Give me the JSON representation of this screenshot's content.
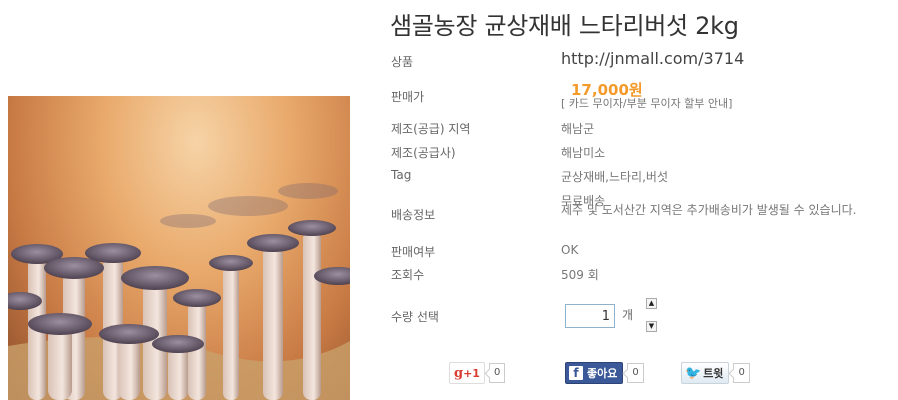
{
  "product": {
    "title": "샘골농장 균상재배 느타리버섯 2kg",
    "image_alt": "oyster-mushrooms-photo"
  },
  "details": {
    "product_label": "상품",
    "product_url": "http://jnmall.com/3714",
    "price_label": "판매가",
    "price": "17,000원",
    "installment_note": "[ 카드 무이자/부분 무이자 할부 안내]",
    "manufacturer_region_label": "제조(공급) 지역",
    "manufacturer_region": "해남군",
    "manufacturer_label": "제조(공급사)",
    "manufacturer": "해남미소",
    "tag_label": "Tag",
    "tags": "균상재배,느타리,버섯",
    "shipping_label": "배송정보",
    "shipping_free": "무료배송",
    "shipping_note": "제주 및 도서산간 지역은 추가배송비가 발생될 수 있습니다.",
    "sale_status_label": "판매여부",
    "sale_status": "OK",
    "views_label": "조회수",
    "views": "509 회"
  },
  "quantity": {
    "label": "수량 선택",
    "value": "1",
    "unit": "개",
    "up_symbol": "▲",
    "down_symbol": "▼"
  },
  "social": {
    "gplus_label": "+1",
    "gplus_count": "0",
    "facebook_label": "좋아요",
    "facebook_count": "0",
    "twitter_label": "트윗",
    "twitter_count": "0"
  },
  "colors": {
    "price": "#f39a2a",
    "facebook": "#3b5998",
    "twitter_bird": "#2aa7e0",
    "gplus": "#d73d32"
  }
}
